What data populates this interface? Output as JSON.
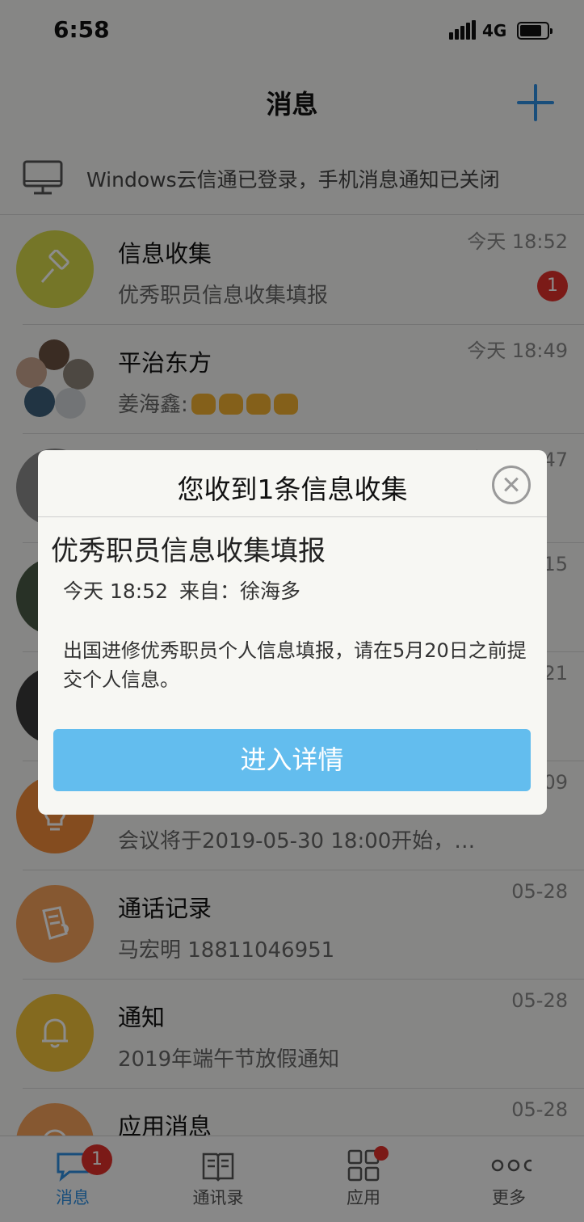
{
  "status_bar": {
    "time": "6:58",
    "network": "4G"
  },
  "header": {
    "title": "消息"
  },
  "pc_banner": {
    "text": "Windows云信通已登录，手机消息通知已关闭"
  },
  "messages": [
    {
      "title": "信息收集",
      "preview": "优秀职员信息收集填报",
      "time": "今天 18:52",
      "badge": "1",
      "avatar_color": "#d6d84a",
      "icon": "gavel-icon"
    },
    {
      "title": "平治东方",
      "preview": "姜海鑫:",
      "time": "今天 18:49",
      "emojis": [
        "clap-emoji",
        "clap-emoji",
        "thumbs-up-emoji",
        "thumbs-up-emoji"
      ],
      "icon": "group-avatar"
    },
    {
      "title": "",
      "preview": "",
      "time": "今天 18:47",
      "icon": "photo-avatar"
    },
    {
      "title": "",
      "preview": "",
      "time": "15",
      "icon": "photo-avatar"
    },
    {
      "title": "",
      "preview": "",
      "time": "21",
      "icon": "photo-avatar"
    },
    {
      "title": "",
      "preview": "会议将于2019-05-30 18:00开始，…",
      "time": "09",
      "avatar_color": "#f08a3a",
      "icon": "lightbulb-icon"
    },
    {
      "title": "通话记录",
      "preview": "马宏明  18811046951",
      "time": "05-28",
      "avatar_color": "#f5a05a",
      "icon": "call-record-icon"
    },
    {
      "title": "通知",
      "preview": "2019年端午节放假通知",
      "time": "05-28",
      "avatar_color": "#f0c23a",
      "icon": "bell-icon"
    },
    {
      "title": "应用消息",
      "preview": "",
      "time": "05-28",
      "avatar_color": "#f5a05a",
      "icon": "app-icon"
    }
  ],
  "dialog": {
    "title": "您收到1条信息收集",
    "form_title": "优秀职员信息收集填报",
    "time": "今天 18:52",
    "from_label": "来自：",
    "from_name": "徐海多",
    "description": "出国进修优秀职员个人信息填报，请在5月20日之前提交个人信息。",
    "button": "进入详情"
  },
  "tabbar": {
    "tabs": [
      {
        "label": "消息",
        "badge": "1",
        "active": true
      },
      {
        "label": "通讯录"
      },
      {
        "label": "应用",
        "dot": true
      },
      {
        "label": "更多"
      }
    ]
  },
  "colors": {
    "accent": "#2f8fe0",
    "button": "#63bdee",
    "badge": "#e0302a"
  }
}
